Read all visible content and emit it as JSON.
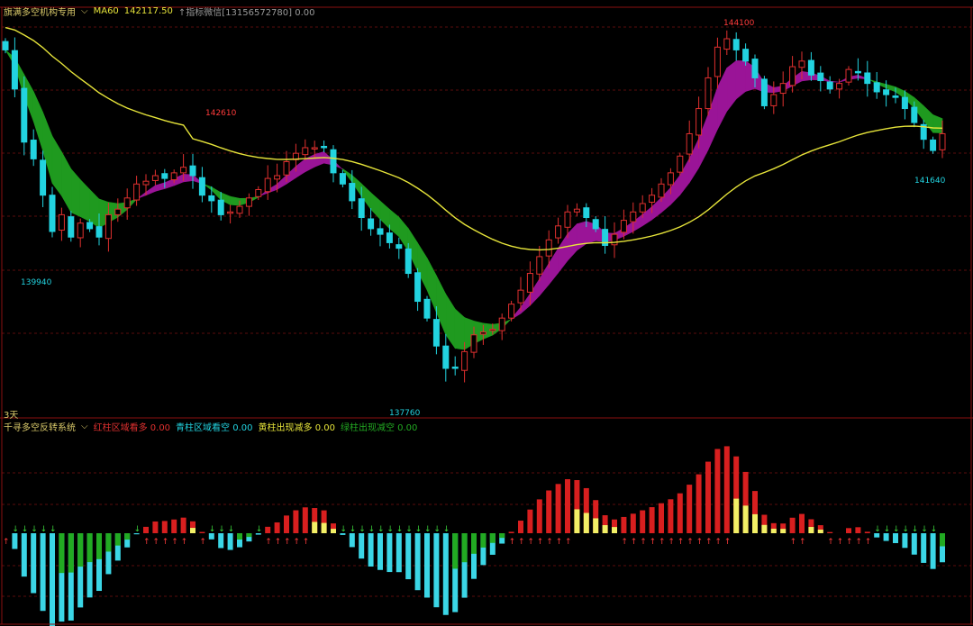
{
  "colors": {
    "background": "#000000",
    "up_candle": "#e0302f",
    "down_candle": "#22d3e0",
    "ma_line": "#e6e43a",
    "ribbon_bear": "#1f9a1f",
    "ribbon_bull": "#9a1497",
    "grid": "#5a0b0b",
    "hist_red": "#d81f1f",
    "hist_cyan": "#3bd6e6",
    "hist_green": "#22aa22",
    "hist_yellow": "#f2ef66"
  },
  "top_header": {
    "indicator_name": "旗满多空机构专用",
    "ma_label": "MA60",
    "ma_value": "142117.50",
    "note": "↑指标微信[13156572780] 0.00"
  },
  "bottom_header": {
    "period_label": "3天",
    "indicator_name": "千寻多空反转系统",
    "items": [
      {
        "label": "红柱区域看多",
        "value": "0.00",
        "color": "#e0302f"
      },
      {
        "label": "青柱区域看空",
        "value": "0.00",
        "color": "#22d3e0"
      },
      {
        "label": "黄柱出现减多",
        "value": "0.00",
        "color": "#e6e43a"
      },
      {
        "label": "绿柱出现减空",
        "value": "0.00",
        "color": "#22aa22"
      }
    ]
  },
  "price_labels": {
    "high_1": "142610",
    "low_1": "139940",
    "low_2": "137760",
    "high_2": "144100",
    "last_low": "141640"
  },
  "chart_data": [
    {
      "type": "candlestick",
      "title": "旗满多空机构专用",
      "series_ma_name": "MA60",
      "ylim": [
        137500,
        144400
      ],
      "closes": [
        143700,
        143000,
        142050,
        141750,
        141100,
        140450,
        140750,
        140350,
        140600,
        140500,
        140350,
        140750,
        140850,
        141050,
        141300,
        141350,
        141450,
        141400,
        141500,
        141600,
        141450,
        141100,
        141000,
        140750,
        140800,
        140900,
        141050,
        141200,
        141400,
        141450,
        141700,
        141850,
        141950,
        141950,
        141950,
        141500,
        141300,
        141000,
        140700,
        140500,
        140400,
        140250,
        140150,
        139700,
        139200,
        138900,
        138400,
        138000,
        138000,
        138300,
        138600,
        138650,
        138700,
        138900,
        139150,
        139400,
        139700,
        140000,
        140300,
        140550,
        140800,
        140850,
        140700,
        140500,
        140200,
        140400,
        140650,
        140800,
        140950,
        141100,
        141300,
        141500,
        141800,
        142200,
        142650,
        143200,
        143750,
        143900,
        143700,
        143500,
        143200,
        142700,
        142900,
        143100,
        143400,
        143500,
        143250,
        143150,
        143000,
        143100,
        143350,
        143300,
        143100,
        142950,
        142900,
        142850,
        142650,
        142400,
        142100,
        141900,
        142200
      ]
    },
    {
      "type": "bar",
      "title": "千寻多空反转系统",
      "zero_line": true,
      "ylim": [
        -1.0,
        1.0
      ]
    }
  ]
}
